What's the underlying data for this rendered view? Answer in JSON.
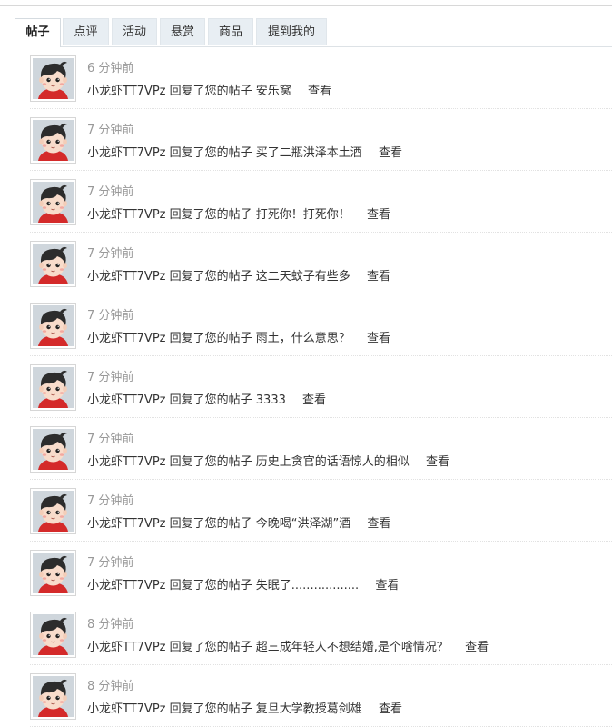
{
  "tabs": [
    {
      "label": "帖子",
      "active": true
    },
    {
      "label": "点评",
      "active": false
    },
    {
      "label": "活动",
      "active": false
    },
    {
      "label": "悬赏",
      "active": false
    },
    {
      "label": "商品",
      "active": false
    },
    {
      "label": "提到我的",
      "active": false
    }
  ],
  "notifications": [
    {
      "time": "6 分钟前",
      "user": "小龙虾TT7VPz",
      "action": "回复了您的帖子",
      "post": "安乐窝",
      "link": "查看"
    },
    {
      "time": "7 分钟前",
      "user": "小龙虾TT7VPz",
      "action": "回复了您的帖子",
      "post": "买了二瓶洪泽本土酒",
      "link": "查看"
    },
    {
      "time": "7 分钟前",
      "user": "小龙虾TT7VPz",
      "action": "回复了您的帖子",
      "post": "打死你！打死你！",
      "link": "查看"
    },
    {
      "time": "7 分钟前",
      "user": "小龙虾TT7VPz",
      "action": "回复了您的帖子",
      "post": "这二天蚊子有些多",
      "link": "查看"
    },
    {
      "time": "7 分钟前",
      "user": "小龙虾TT7VPz",
      "action": "回复了您的帖子",
      "post": "雨土，什么意思？",
      "link": "查看"
    },
    {
      "time": "7 分钟前",
      "user": "小龙虾TT7VPz",
      "action": "回复了您的帖子",
      "post": "3333",
      "link": "查看"
    },
    {
      "time": "7 分钟前",
      "user": "小龙虾TT7VPz",
      "action": "回复了您的帖子",
      "post": "历史上贪官的话语惊人的相似",
      "link": "查看"
    },
    {
      "time": "7 分钟前",
      "user": "小龙虾TT7VPz",
      "action": "回复了您的帖子",
      "post": "今晚喝“洪泽湖”酒",
      "link": "查看"
    },
    {
      "time": "7 分钟前",
      "user": "小龙虾TT7VPz",
      "action": "回复了您的帖子",
      "post": "失眠了..................",
      "link": "查看"
    },
    {
      "time": "8 分钟前",
      "user": "小龙虾TT7VPz",
      "action": "回复了您的帖子",
      "post": "超三成年轻人不想结婚,是个啥情况？",
      "link": "查看"
    },
    {
      "time": "8 分钟前",
      "user": "小龙虾TT7VPz",
      "action": "回复了您的帖子",
      "post": "复旦大学教授葛剑雄",
      "link": "查看"
    }
  ],
  "avatar_icon": "cartoon-boy-avatar",
  "colors": {
    "tab_bg": "#e8eef3",
    "time_text": "#999999",
    "body_text": "#333333"
  }
}
